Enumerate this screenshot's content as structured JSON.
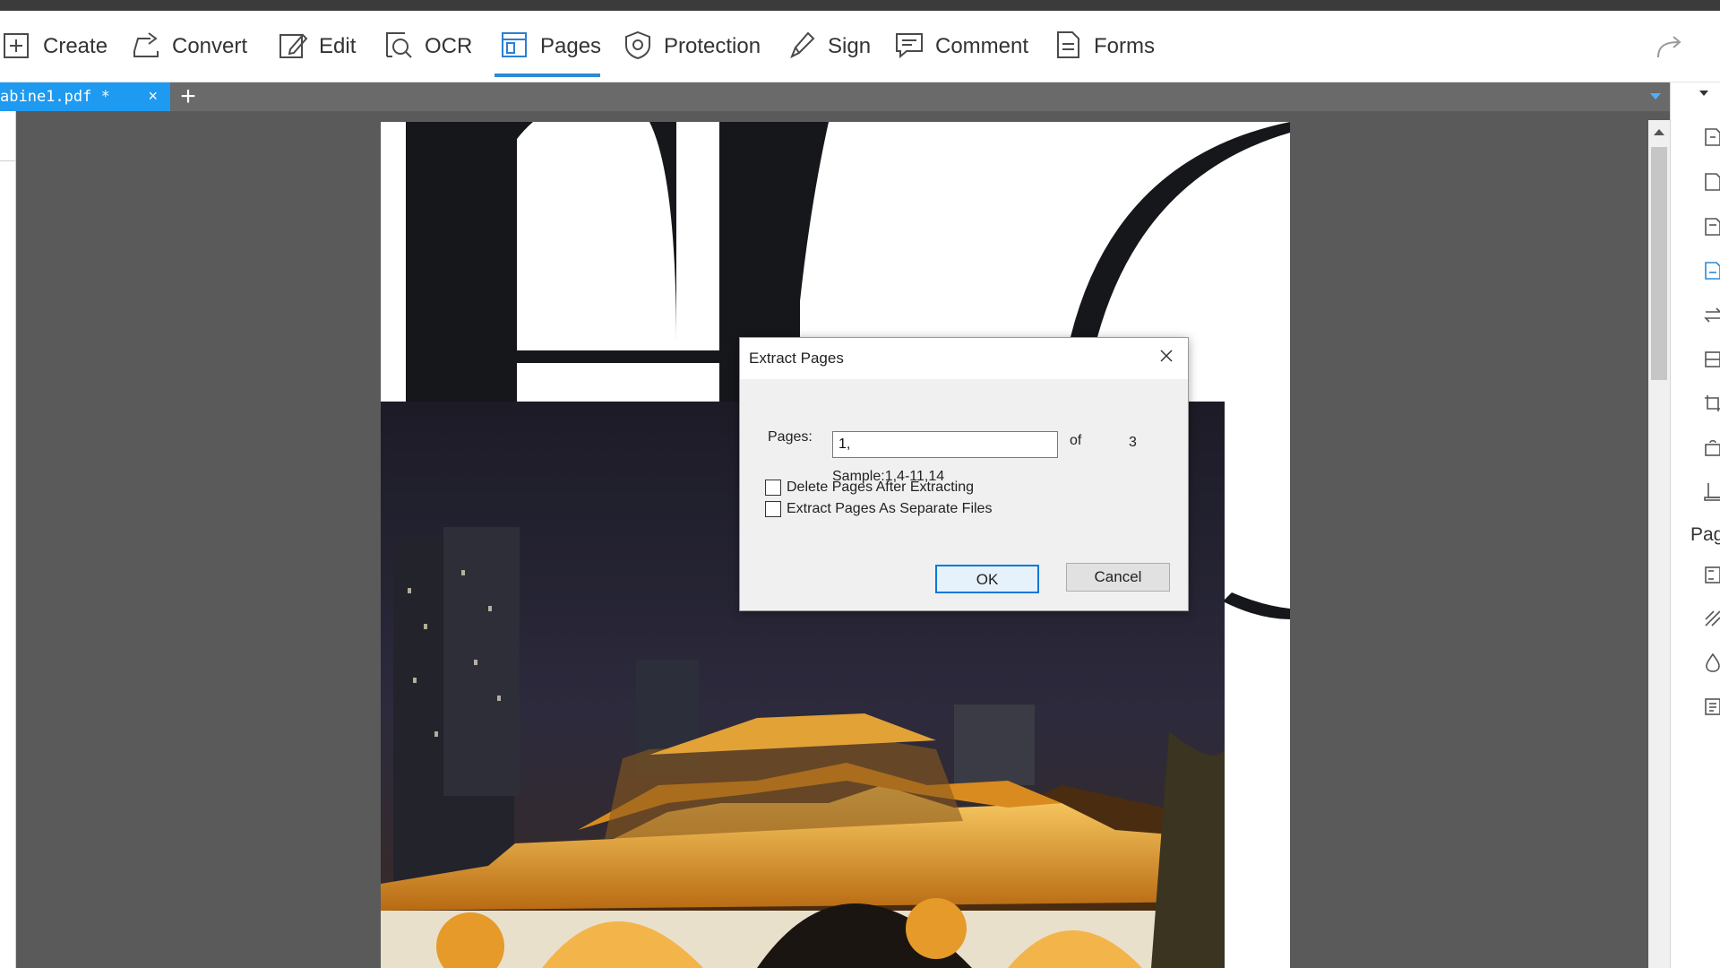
{
  "toolbar": {
    "items": [
      {
        "label": "Create",
        "icon": "create-icon"
      },
      {
        "label": "Convert",
        "icon": "convert-icon"
      },
      {
        "label": "Edit",
        "icon": "edit-icon"
      },
      {
        "label": "OCR",
        "icon": "ocr-icon"
      },
      {
        "label": "Pages",
        "icon": "pages-icon",
        "active": true
      },
      {
        "label": "Protection",
        "icon": "protection-icon"
      },
      {
        "label": "Sign",
        "icon": "sign-icon"
      },
      {
        "label": "Comment",
        "icon": "comment-icon"
      },
      {
        "label": "Forms",
        "icon": "forms-icon"
      }
    ],
    "redo_icon": "redo-icon"
  },
  "tabs": {
    "current": {
      "name": "abine1.pdf *",
      "close": "×"
    },
    "add": "+"
  },
  "right_panel": {
    "label": "Pag"
  },
  "dialog": {
    "title": "Extract Pages",
    "pages_label": "Pages:",
    "pages_value": "1,",
    "of_label": "of",
    "total_pages": "3",
    "sample": "Sample:1,4-11,14",
    "delete_after_label": "Delete Pages After Extracting",
    "delete_after_checked": false,
    "separate_files_label": "Extract Pages As Separate Files",
    "separate_files_checked": false,
    "ok_label": "OK",
    "cancel_label": "Cancel"
  },
  "colors": {
    "accent": "#2a8bd8",
    "tab_active": "#1e9af0",
    "workspace": "#5a5a5a"
  }
}
